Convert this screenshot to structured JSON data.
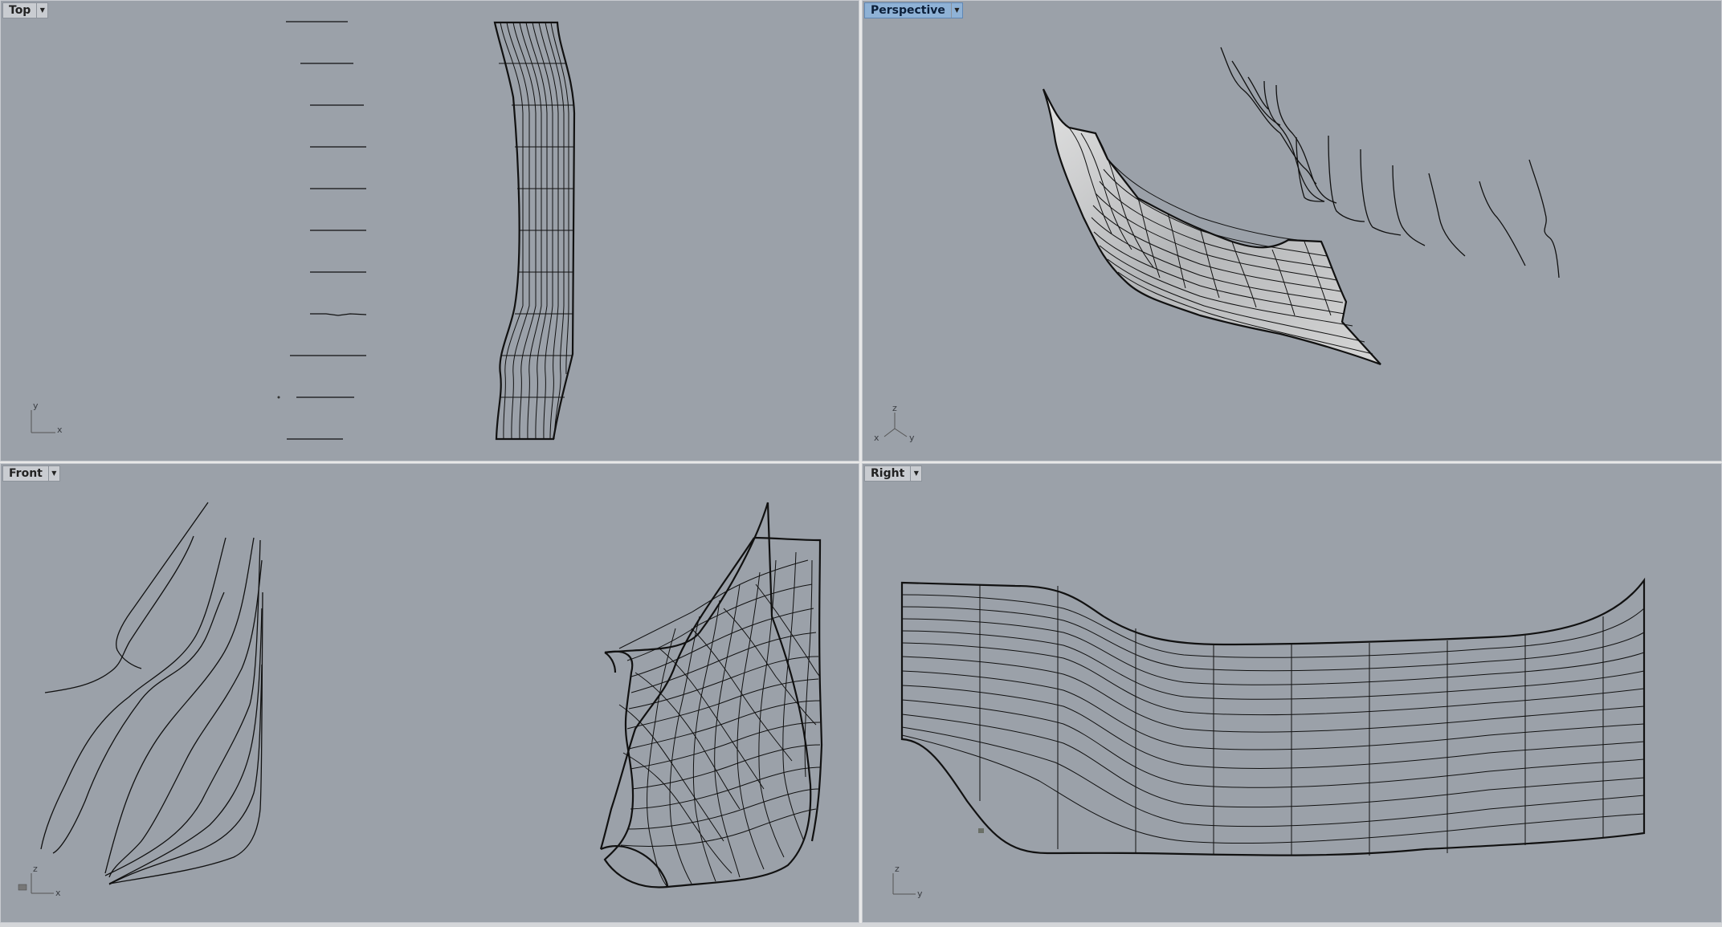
{
  "viewports": {
    "top": {
      "label": "Top",
      "axis_x": "x",
      "axis_y": "y"
    },
    "perspective": {
      "label": "Perspective",
      "axis_x": "x",
      "axis_y": "y",
      "axis_z": "z"
    },
    "front": {
      "label": "Front",
      "axis_x": "x",
      "axis_z": "z"
    },
    "right": {
      "label": "Right",
      "axis_y": "y",
      "axis_z": "z"
    }
  },
  "icons": {
    "dropdown": "chevron-down-icon",
    "axes": "axis-gizmo-icon"
  }
}
